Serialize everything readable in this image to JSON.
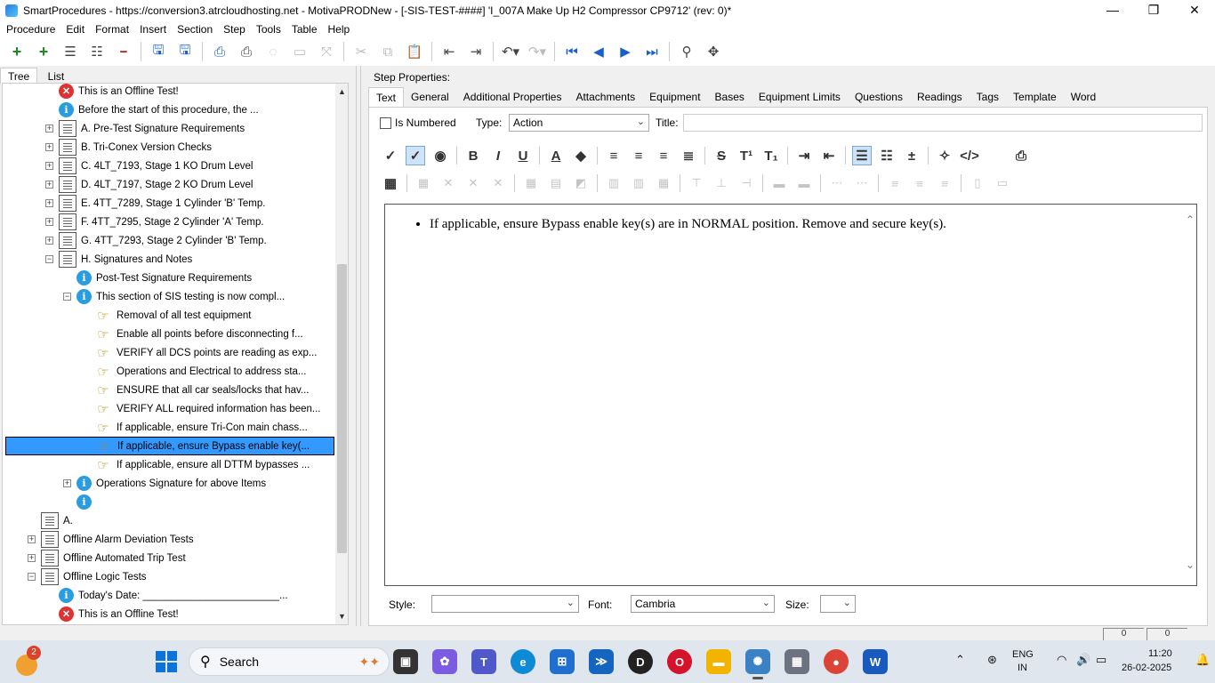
{
  "window": {
    "title": "SmartProcedures - https://conversion3.atrcloudhosting.net - MotivaPRODNew - [-SIS-TEST-####] 'I_007A Make Up H2 Compressor CP9712' (rev: 0)*",
    "controls": [
      "—",
      "❐",
      "✕"
    ]
  },
  "menu": [
    "Procedure",
    "Edit",
    "Format",
    "Insert",
    "Section",
    "Step",
    "Tools",
    "Table",
    "Help"
  ],
  "left_tabs": [
    "Tree",
    "List"
  ],
  "tree": [
    {
      "label": "This is an Offline Test!",
      "icon": "error-icon",
      "glyph": "✕",
      "indent": 1,
      "exp": ""
    },
    {
      "label": "Before the start of this procedure, the ...",
      "icon": "info-icon",
      "glyph": "i",
      "indent": 1,
      "exp": ""
    },
    {
      "label": "A. Pre-Test Signature Requirements",
      "icon": "section-icon",
      "glyph": "",
      "indent": 1,
      "exp": "+"
    },
    {
      "label": "B. Tri-Conex Version Checks",
      "icon": "section-icon",
      "glyph": "",
      "indent": 1,
      "exp": "+"
    },
    {
      "label": "C. 4LT_7193, Stage 1 KO Drum Level",
      "icon": "section-icon",
      "glyph": "",
      "indent": 1,
      "exp": "+"
    },
    {
      "label": "D. 4LT_7197, Stage 2 KO Drum Level",
      "icon": "section-icon",
      "glyph": "",
      "indent": 1,
      "exp": "+"
    },
    {
      "label": "E. 4TT_7289, Stage 1 Cylinder 'B' Temp.",
      "icon": "section-icon",
      "glyph": "",
      "indent": 1,
      "exp": "+"
    },
    {
      "label": "F. 4TT_7295, Stage 2 Cylinder 'A' Temp.",
      "icon": "section-icon",
      "glyph": "",
      "indent": 1,
      "exp": "+"
    },
    {
      "label": "G. 4TT_7293, Stage 2 Cylinder 'B' Temp.",
      "icon": "section-icon",
      "glyph": "",
      "indent": 1,
      "exp": "+"
    },
    {
      "label": "H. Signatures and Notes",
      "icon": "section-icon",
      "glyph": "",
      "indent": 1,
      "exp": "−"
    },
    {
      "label": "Post-Test Signature Requirements",
      "icon": "info-icon",
      "glyph": "i",
      "indent": 2,
      "exp": ""
    },
    {
      "label": "This section of SIS testing is now compl...",
      "icon": "info-icon",
      "glyph": "i",
      "indent": 2,
      "exp": "−"
    },
    {
      "label": "Removal of all test equipment",
      "icon": "action-hand-icon",
      "glyph": "☞",
      "indent": 3,
      "exp": ""
    },
    {
      "label": "Enable all points before disconnecting f...",
      "icon": "action-hand-icon",
      "glyph": "☞",
      "indent": 3,
      "exp": ""
    },
    {
      "label": "VERIFY all DCS points are reading as exp...",
      "icon": "action-hand-icon",
      "glyph": "☞",
      "indent": 3,
      "exp": ""
    },
    {
      "label": "Operations and Electrical to address sta...",
      "icon": "action-hand-icon",
      "glyph": "☞",
      "indent": 3,
      "exp": ""
    },
    {
      "label": "ENSURE that all car seals/locks that hav...",
      "icon": "action-hand-icon",
      "glyph": "☞",
      "indent": 3,
      "exp": ""
    },
    {
      "label": "VERIFY ALL required information has been...",
      "icon": "action-hand-icon",
      "glyph": "☞",
      "indent": 3,
      "exp": ""
    },
    {
      "label": "If applicable, ensure Tri-Con main chass...",
      "icon": "action-hand-icon",
      "glyph": "☞",
      "indent": 3,
      "exp": ""
    },
    {
      "label": "If applicable, ensure Bypass enable key(...",
      "icon": "action-hand-icon",
      "glyph": "☞",
      "indent": 3,
      "exp": "",
      "selected": true
    },
    {
      "label": "If applicable, ensure all DTTM bypasses ...",
      "icon": "action-hand-icon",
      "glyph": "☞",
      "indent": 3,
      "exp": ""
    },
    {
      "label": "Operations Signature for above Items",
      "icon": "info-icon",
      "glyph": "i",
      "indent": 2,
      "exp": "+"
    },
    {
      "label": "",
      "icon": "info-icon",
      "glyph": "i",
      "indent": 2,
      "exp": ""
    },
    {
      "label": "A.",
      "icon": "section-icon",
      "glyph": "",
      "indent": 0,
      "exp": ""
    },
    {
      "label": "Offline Alarm Deviation Tests",
      "icon": "section-icon",
      "glyph": "",
      "indent": 0,
      "exp": "+"
    },
    {
      "label": "Offline Automated Trip Test",
      "icon": "section-icon",
      "glyph": "",
      "indent": 0,
      "exp": "+"
    },
    {
      "label": "Offline Logic Tests",
      "icon": "section-icon",
      "glyph": "",
      "indent": 0,
      "exp": "−"
    },
    {
      "label": "Today's Date: ________________________...",
      "icon": "info-icon",
      "glyph": "i",
      "indent": 1,
      "exp": ""
    },
    {
      "label": "This is an Offline Test!",
      "icon": "error-icon",
      "glyph": "✕",
      "indent": 1,
      "exp": ""
    }
  ],
  "step_properties": {
    "heading": "Step Properties:",
    "tabs": [
      "Text",
      "General",
      "Additional Properties",
      "Attachments",
      "Equipment",
      "Bases",
      "Equipment Limits",
      "Questions",
      "Readings",
      "Tags",
      "Template",
      "Word"
    ],
    "is_numbered_label": "Is Numbered",
    "type_label": "Type:",
    "type_value": "Action",
    "title_label": "Title:",
    "title_value": "",
    "body_bullet": "If applicable, ensure Bypass enable key(s) are in NORMAL position. Remove and secure key(s).",
    "style_label": "Style:",
    "style_value": "",
    "font_label": "Font:",
    "font_value": "Cambria",
    "size_label": "Size:",
    "size_value": ""
  },
  "status": {
    "cell1": "0",
    "cell2": "0"
  },
  "taskbar": {
    "notification_count": "2",
    "search_placeholder": "Search",
    "lang1": "ENG",
    "lang2": "IN",
    "time": "11:20",
    "date": "26-02-2025"
  },
  "colors": {
    "selection": "#3399ff",
    "accent": "#0a74da"
  }
}
